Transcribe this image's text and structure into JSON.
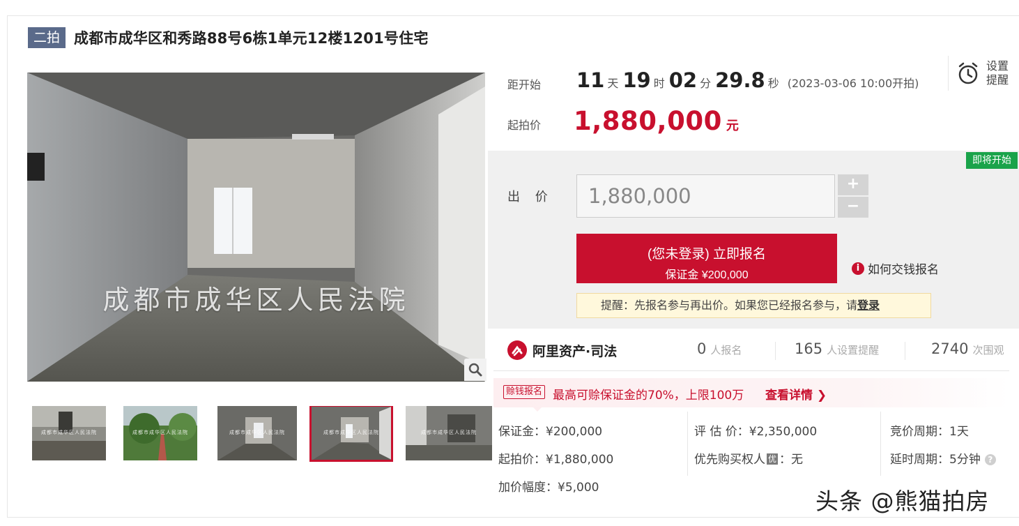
{
  "header": {
    "tag": "二拍",
    "title": "成都市成华区和秀路88号6栋1单元12楼1201号住宅"
  },
  "gallery": {
    "watermark": "成都市成华区人民法院",
    "thumb_watermark": "成都市成华区人民法院",
    "zoom_icon": "magnifier-icon",
    "thumbnails": [
      {
        "name": "thumb-1",
        "active": false
      },
      {
        "name": "thumb-2",
        "active": false
      },
      {
        "name": "thumb-3",
        "active": false
      },
      {
        "name": "thumb-4",
        "active": true
      },
      {
        "name": "thumb-5",
        "active": false
      }
    ]
  },
  "countdown": {
    "label": "距开始",
    "days": "11",
    "days_unit": "天",
    "hours": "19",
    "hours_unit": "时",
    "minutes": "02",
    "minutes_unit": "分",
    "seconds": "29.8",
    "seconds_unit": "秒",
    "start_time": "(2023-03-06 10:00开拍)"
  },
  "reminder": {
    "icon": "alarm-clock-icon",
    "line1": "设置",
    "line2": "提醒"
  },
  "start_price": {
    "label": "起拍价",
    "value": "1,880,000",
    "unit": "元"
  },
  "bid": {
    "badge": "即将开始",
    "label": "出 价",
    "input_value": "1,880,000",
    "plus": "+",
    "minus": "−",
    "signup_line1": "(您未登录) 立即报名",
    "signup_line2": "保证金 ¥200,000",
    "howpay_icon": "i",
    "howpay_text": "如何交钱报名",
    "notice_text": "提醒：先报名参与再出价。如果您已经报名参与，请",
    "notice_link": "登录"
  },
  "stats": {
    "brand": "阿里资产·司法",
    "signups": "0",
    "signups_label": "人报名",
    "reminders": "165",
    "reminders_label": "人设置提醒",
    "views": "2740",
    "views_label": "次围观"
  },
  "promo": {
    "tag": "赊钱报名",
    "text": "最高可赊保证金的70%，上限100万",
    "link": "查看详情 ❯"
  },
  "details": {
    "deposit": "保证金：¥200,000",
    "start_price": "起拍价：¥1,880,000",
    "increment": "加价幅度：¥5,000",
    "appraisal": "评 估 价：¥2,350,000",
    "priority_prefix": "优先购买权人",
    "priority_badge": "优",
    "priority_value": "：无",
    "cycle": "竞价周期：1天",
    "delay": "延时周期：5分钟",
    "help_icon": "?"
  },
  "credit": "头条 @熊猫拍房",
  "colors": {
    "accent_red": "#c8102e",
    "tag_bg": "#5a6a8a",
    "soon_green": "#1aa34a"
  }
}
